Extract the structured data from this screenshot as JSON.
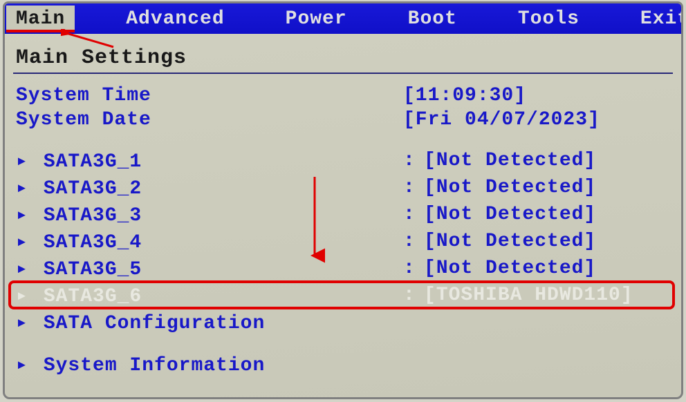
{
  "menu": {
    "items": [
      "Main",
      "Advanced",
      "Power",
      "Boot",
      "Tools",
      "Exit"
    ],
    "active": 0
  },
  "page_title": "Main Settings",
  "system_time": {
    "label": "System Time",
    "value": "[11:09:30]"
  },
  "system_date": {
    "label": "System Date",
    "value": "[Fri 04/07/2023]"
  },
  "sata_ports": [
    {
      "label": "SATA3G_1",
      "value": "[Not Detected]"
    },
    {
      "label": "SATA3G_2",
      "value": "[Not Detected]"
    },
    {
      "label": "SATA3G_3",
      "value": "[Not Detected]"
    },
    {
      "label": "SATA3G_4",
      "value": "[Not Detected]"
    },
    {
      "label": "SATA3G_5",
      "value": "[Not Detected]"
    },
    {
      "label": "SATA3G_6",
      "value": "[TOSHIBA HDWD110]"
    }
  ],
  "sata_config_label": "SATA Configuration",
  "system_info_label": "System Information",
  "selected_index": 5,
  "glyphs": {
    "submenu_arrow": "▸"
  },
  "colors": {
    "menu_bg": "#1414c8",
    "text_blue": "#1818c8",
    "text_dark": "#181818",
    "highlight": "#e00000",
    "bg": "#c8c8b8"
  }
}
